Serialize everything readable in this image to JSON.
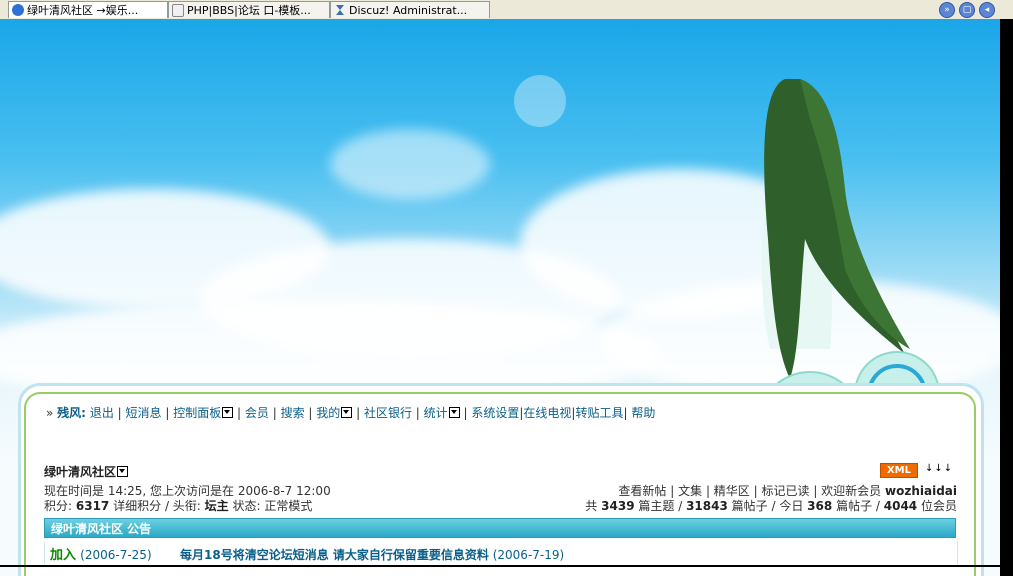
{
  "tabs": [
    {
      "label": "绿叶清风社区 →娱乐...",
      "icon": "ie-page-icon",
      "active": true
    },
    {
      "label": "PHP|BBS|论坛 口-模板...",
      "icon": "page-icon",
      "active": false
    },
    {
      "label": "Discuz! Administrat...",
      "icon": "hourglass-icon",
      "active": false
    }
  ],
  "nav": {
    "prefix": "»",
    "username": "残风:",
    "items": [
      "退出",
      "短消息",
      "控制面板",
      "会员",
      "搜索",
      "我的",
      "社区银行",
      "统计",
      "系统设置",
      "在线电视",
      "转贴工具",
      "帮助"
    ]
  },
  "forum": {
    "name": "绿叶清风社区",
    "time_info": "现在时间是 14:25, 您上次访问是在 2006-8-7 12:00",
    "credits_label": "积分:",
    "credits": "6317",
    "detail_label": "详细积分",
    "title_label": "头衔:",
    "title": "坛主",
    "status_label": "状态:",
    "status": "正常模式"
  },
  "quicklinks": {
    "items": [
      "查看新帖",
      "文集",
      "精华区",
      "标记已读"
    ],
    "welcome": "欢迎新会员",
    "new_member": "wozhiaidai"
  },
  "stats": {
    "prefix": "共",
    "topics": "3439",
    "topics_label": "篇主题",
    "posts": "31843",
    "posts_label": "篇帖子",
    "today_label": "今日",
    "today": "368",
    "today_unit": "篇帖子",
    "members": "4044",
    "members_label": "位会员"
  },
  "xml_label": "XML",
  "arrows": "↓↓↓",
  "announcement": {
    "title": "绿叶清风社区 公告",
    "item1_title": "加入",
    "item1_date": "(2006-7-25)",
    "item2_title": "每月18号将清空论坛短消息 请大家自行保留重要信息资料",
    "item2_date": "(2006-7-19)"
  },
  "colors": {
    "link": "#0a5f8a",
    "announce_bar": "#2aa9c8",
    "xml_badge": "#ee6b00"
  }
}
